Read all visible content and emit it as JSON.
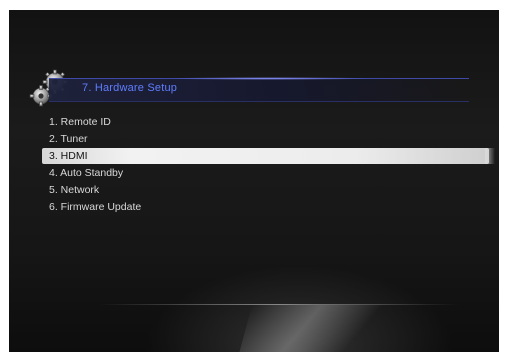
{
  "header": {
    "title": "7. Hardware Setup",
    "accent_color": "#5f7dff"
  },
  "menu": {
    "selected_index": 2,
    "items": [
      {
        "label": "1. Remote ID"
      },
      {
        "label": "2. Tuner"
      },
      {
        "label": "3. HDMI"
      },
      {
        "label": "4. Auto Standby"
      },
      {
        "label": "5. Network"
      },
      {
        "label": "6. Firmware Update"
      }
    ]
  },
  "icons": {
    "header_icon": "gears-icon"
  }
}
